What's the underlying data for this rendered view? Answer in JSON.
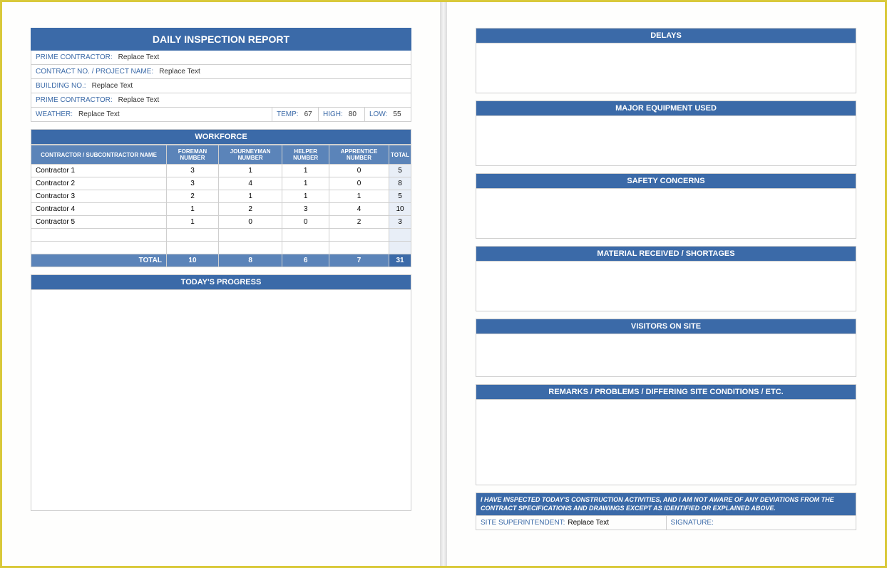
{
  "title": "DAILY INSPECTION REPORT",
  "fields": {
    "prime1": {
      "label": "PRIME CONTRACTOR:",
      "value": "Replace Text"
    },
    "contract": {
      "label": "CONTRACT NO. / PROJECT NAME:",
      "value": "Replace Text"
    },
    "building": {
      "label": "BUILDING NO.:",
      "value": "Replace Text"
    },
    "prime2": {
      "label": "PRIME CONTRACTOR:",
      "value": "Replace Text"
    },
    "weather": {
      "label": "WEATHER:",
      "value": "Replace Text"
    },
    "temp": {
      "label": "TEMP:",
      "value": "67"
    },
    "high": {
      "label": "HIGH:",
      "value": "80"
    },
    "low": {
      "label": "LOW:",
      "value": "55"
    }
  },
  "workforce": {
    "header": "WORKFORCE",
    "columns": [
      "CONTRACTOR / SUBCONTRACTOR NAME",
      "FOREMAN NUMBER",
      "JOURNEYMAN NUMBER",
      "HELPER NUMBER",
      "APPRENTICE NUMBER",
      "TOTAL"
    ],
    "rows": [
      {
        "name": "Contractor 1",
        "f": "3",
        "j": "1",
        "h": "1",
        "a": "0",
        "t": "5"
      },
      {
        "name": "Contractor 2",
        "f": "3",
        "j": "4",
        "h": "1",
        "a": "0",
        "t": "8"
      },
      {
        "name": "Contractor 3",
        "f": "2",
        "j": "1",
        "h": "1",
        "a": "1",
        "t": "5"
      },
      {
        "name": "Contractor 4",
        "f": "1",
        "j": "2",
        "h": "3",
        "a": "4",
        "t": "10"
      },
      {
        "name": "Contractor 5",
        "f": "1",
        "j": "0",
        "h": "0",
        "a": "2",
        "t": "3"
      }
    ],
    "total": {
      "label": "TOTAL",
      "f": "10",
      "j": "8",
      "h": "6",
      "a": "7",
      "t": "31"
    }
  },
  "progress_header": "TODAY'S PROGRESS",
  "sections": {
    "delays": "DELAYS",
    "equipment": "MAJOR EQUIPMENT USED",
    "safety": "SAFETY CONCERNS",
    "material": "MATERIAL RECEIVED / SHORTAGES",
    "visitors": "VISITORS ON SITE",
    "remarks": "REMARKS / PROBLEMS / DIFFERING SITE CONDITIONS / ETC."
  },
  "statement": "I HAVE INSPECTED TODAY'S CONSTRUCTION ACTIVITIES, AND I AM NOT AWARE OF ANY DEVIATIONS FROM THE CONTRACT SPECIFICATIONS AND DRAWINGS EXCEPT AS IDENTIFIED OR EXPLAINED ABOVE.",
  "signature": {
    "super_label": "SITE SUPERINTENDENT:",
    "super_value": "Replace Text",
    "sig_label": "SIGNATURE:"
  }
}
